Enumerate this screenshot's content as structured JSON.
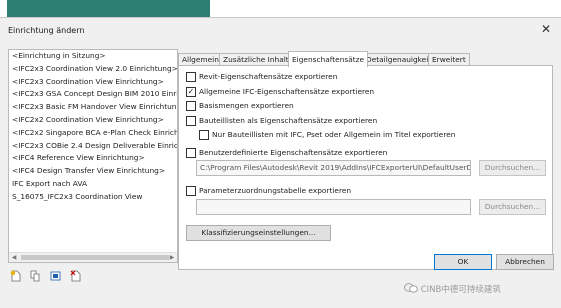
{
  "dialog": {
    "title": "Einrichtung ändern",
    "close_glyph": "✕"
  },
  "setups": [
    "<Einrichtung in Sitzung>",
    "<IFC2x3 Coordination View 2.0 Einrichtung>",
    "<IFC2x3 Coordination View Einrichtung>",
    "<IFC2x3 GSA Concept Design BIM 2010 Einricht",
    "<IFC2x3 Basic FM Handover View Einrichtung>",
    "<IFC2x2 Coordination View Einrichtung>",
    "<IFC2x2 Singapore BCA e-Plan Check Einrichtur",
    "<IFC2x3 COBie 2.4 Design Deliverable Einrichtun",
    "<IFC4 Reference View Einrichtung>",
    "<IFC4 Design Transfer View Einrichtung>",
    "IFC Export nach AVA",
    "S_16075_IFC2x3 Coordination View"
  ],
  "list_tools": [
    "new-setup-icon",
    "duplicate-setup-icon",
    "rename-setup-icon",
    "delete-setup-icon"
  ],
  "tabs": [
    {
      "label": "Allgemein",
      "active": false
    },
    {
      "label": "Zusätzliche Inhalte",
      "active": false
    },
    {
      "label": "Eigenschaftensätze",
      "active": true
    },
    {
      "label": "Detailgenauigkeit",
      "active": false
    },
    {
      "label": "Erweitert",
      "active": false
    }
  ],
  "options": {
    "revit_psets": {
      "label": "Revit-Eigenschaftensätze exportieren",
      "checked": false
    },
    "ifc_common": {
      "label": "Allgemeine IFC-Eigenschaftensätze exportieren",
      "checked": true
    },
    "base_quantities": {
      "label": "Basismengen exportieren",
      "checked": false
    },
    "schedules": {
      "label": "Bauteillisten als Eigenschaftensätze exportieren",
      "checked": false
    },
    "schedules_filter": {
      "label": "Nur Bauteillisten mit IFC, Pset oder Allgemein im Titel exportieren",
      "checked": false
    },
    "user_defined": {
      "label": "Benutzerdefinierte Eigenschaftensätze exportieren",
      "checked": false
    },
    "user_defined_path": "C:\\Program Files\\Autodesk\\Revit 2019\\AddIns\\IFCExporterUI\\DefaultUserDefinedPa",
    "mapping_table": {
      "label": "Parameterzuordnungstabelle exportieren",
      "checked": false
    },
    "mapping_path": ""
  },
  "buttons": {
    "browse1": "Durchsuchen...",
    "browse2": "Durchsuchen...",
    "classification": "Klassifizierungseinstellungen...",
    "ok": "OK",
    "cancel": "Abbrechen"
  },
  "watermark": "CINB中德可持续建筑",
  "colors": {
    "accent_bar": "#2d7f74",
    "dialog_bg": "#f0f0f0"
  }
}
